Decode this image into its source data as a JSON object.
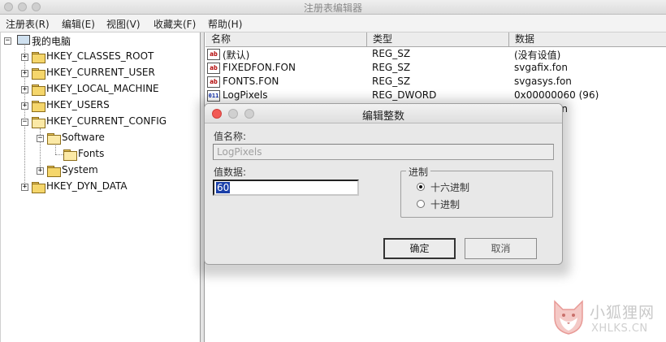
{
  "window": {
    "title": "注册表编辑器"
  },
  "menu": {
    "items": [
      "注册表(R)",
      "编辑(E)",
      "视图(V)",
      "收藏夹(F)",
      "帮助(H)"
    ]
  },
  "tree": {
    "root": "我的电脑",
    "nodes": [
      "HKEY_CLASSES_ROOT",
      "HKEY_CURRENT_USER",
      "HKEY_LOCAL_MACHINE",
      "HKEY_USERS",
      "HKEY_CURRENT_CONFIG",
      "Software",
      "Fonts",
      "System",
      "HKEY_DYN_DATA"
    ]
  },
  "list": {
    "columns": [
      "名称",
      "类型",
      "数据"
    ],
    "rows": [
      {
        "icon": "ab",
        "name": "(默认)",
        "type": "REG_SZ",
        "data": "(没有设值)"
      },
      {
        "icon": "ab",
        "name": "FIXEDFON.FON",
        "type": "REG_SZ",
        "data": "svgafix.fon"
      },
      {
        "icon": "ab",
        "name": "FONTS.FON",
        "type": "REG_SZ",
        "data": "svgasys.fon"
      },
      {
        "icon": "011",
        "name": "LogPixels",
        "type": "REG_DWORD",
        "data": "0x00000060 (96)"
      },
      {
        "icon": "ab",
        "name": "",
        "type": "",
        "data": "on"
      }
    ]
  },
  "dialog": {
    "title": "编辑整数",
    "value_name_label": "值名称:",
    "value_name": "LogPixels",
    "value_data_label": "值数据:",
    "value_data": "60",
    "base_group_label": "进制",
    "radio_hex": "十六进制",
    "radio_dec": "十进制",
    "selected_base": "hex",
    "ok_label": "确定",
    "cancel_label": "取消"
  },
  "watermark": {
    "name": "小狐狸网",
    "url": "XHLKS.CN"
  },
  "colors": {
    "close_button": "#f25a55",
    "selection": "#1a3fa8",
    "folder": "#f5d66b"
  }
}
